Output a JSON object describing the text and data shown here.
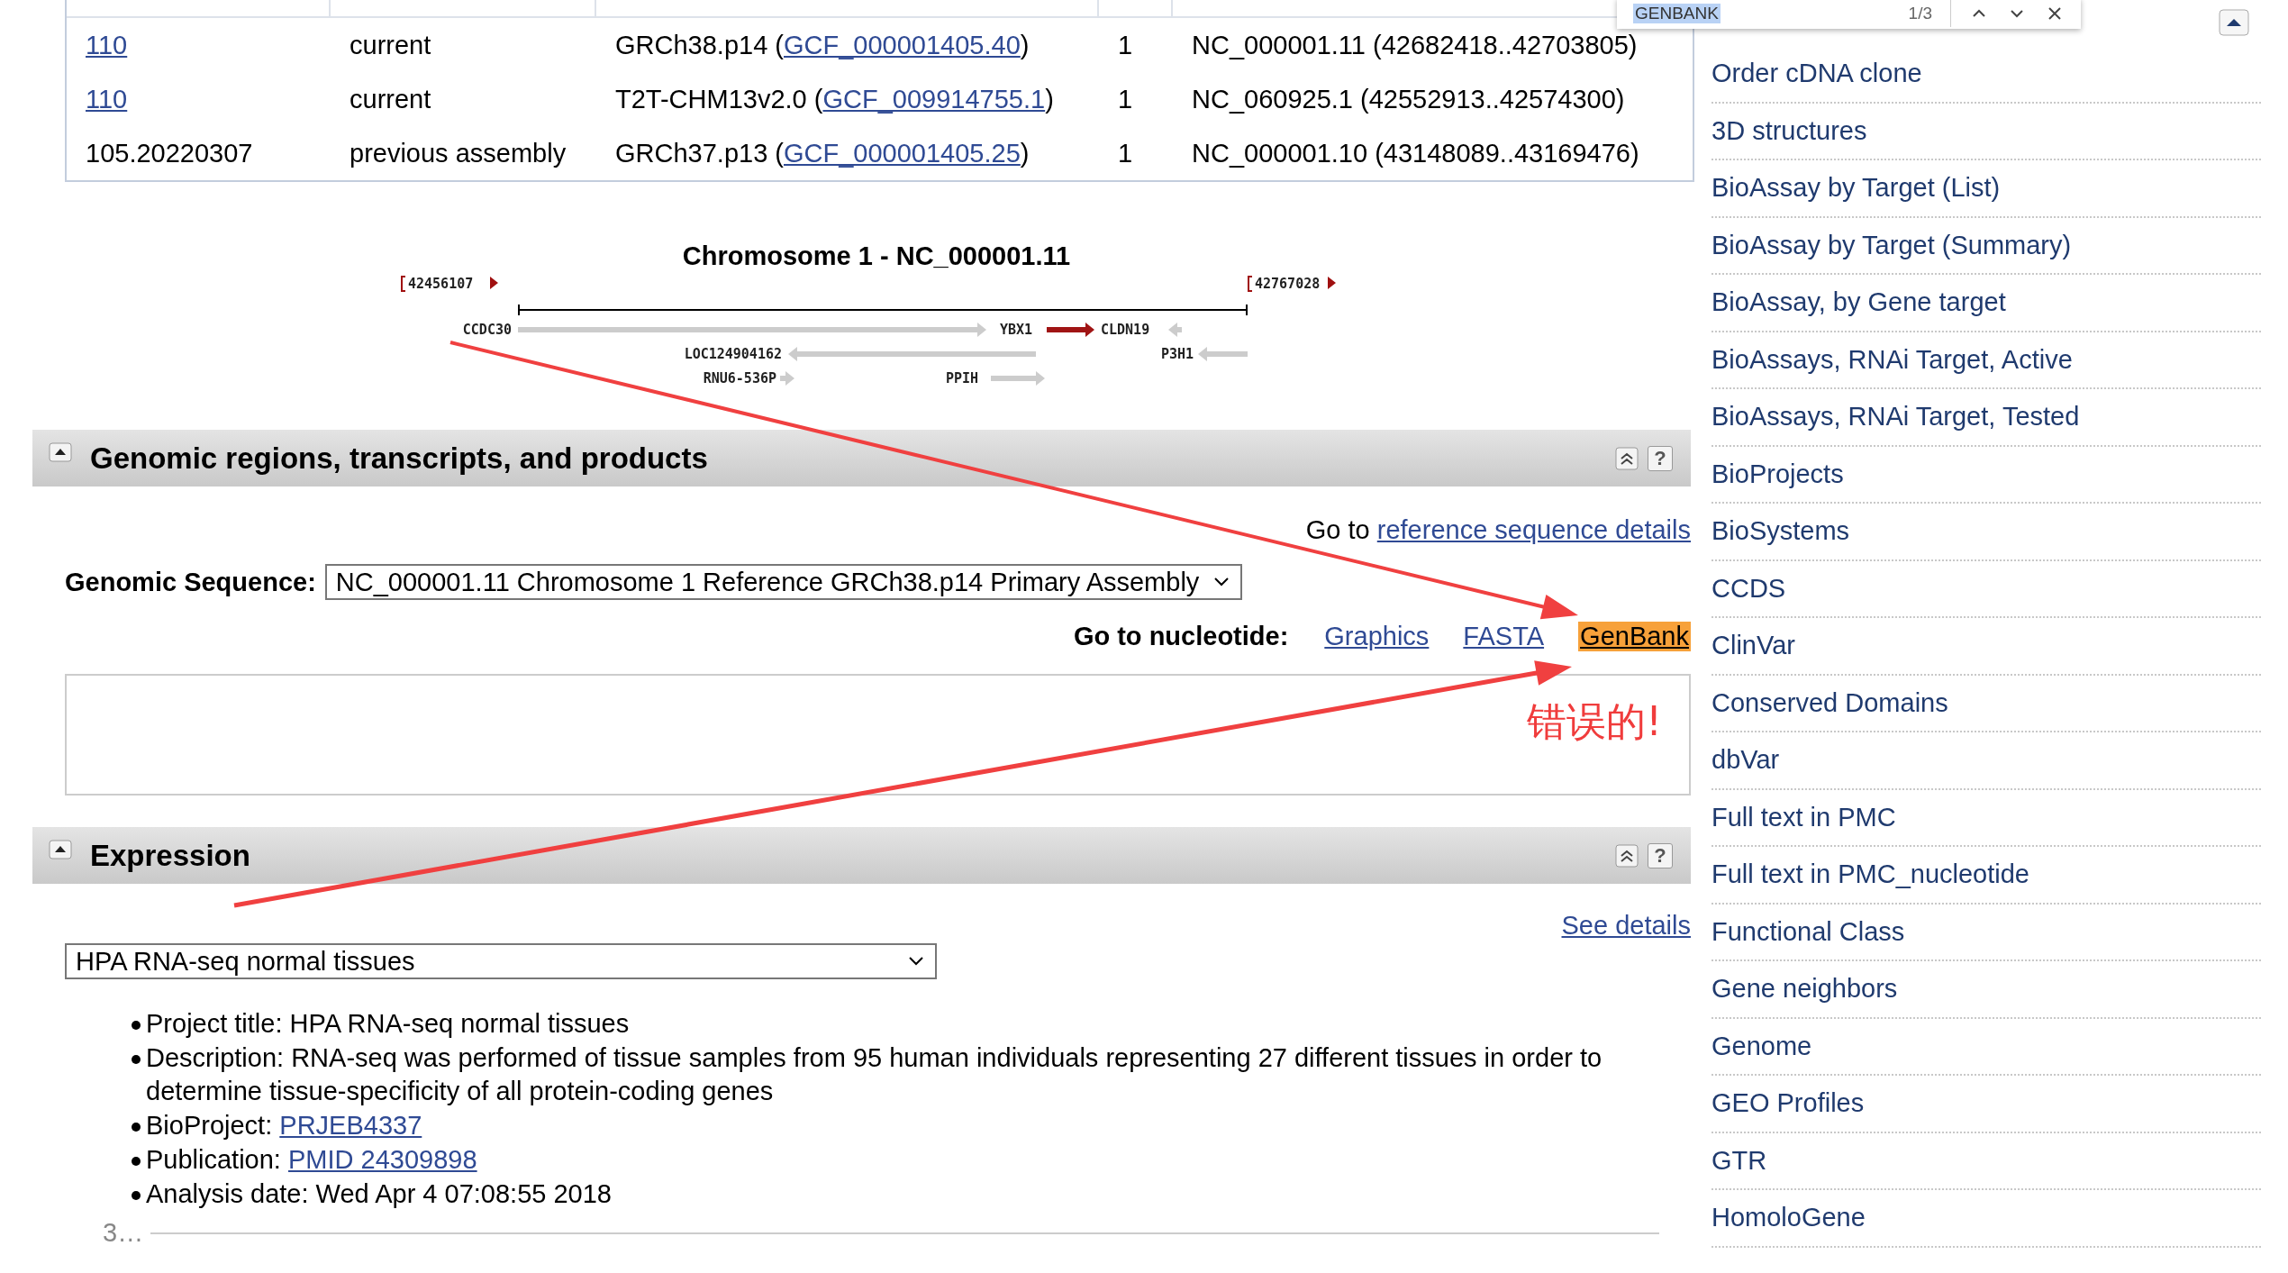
{
  "find_bar": {
    "query": "GENBANK",
    "count": "1/3"
  },
  "assembly_table": {
    "rows": [
      {
        "release": "110",
        "release_is_link": true,
        "status": "current",
        "assembly": "GRCh38.p14 (",
        "accession": "GCF_000001405.40",
        "accession_close": ")",
        "chromosome": "1",
        "location": "NC_000001.11 (42682418..42703805)"
      },
      {
        "release": "110",
        "release_is_link": true,
        "status": "current",
        "assembly": "T2T-CHM13v2.0 (",
        "accession": "GCF_009914755.1",
        "accession_close": ")",
        "chromosome": "1",
        "location": "NC_060925.1 (42552913..42574300)"
      },
      {
        "release": "105.20220307",
        "release_is_link": false,
        "status": "previous assembly",
        "assembly": "GRCh37.p13 (",
        "accession": "GCF_000001405.25",
        "accession_close": ")",
        "chromosome": "1",
        "location": "NC_000001.10 (43148089..43169476)"
      }
    ]
  },
  "gene_map": {
    "title": "Chromosome 1 - NC_000001.11",
    "start": "42456107",
    "end": "42767028",
    "genes": [
      {
        "label": "CCDC30",
        "points_right": true,
        "highlighted": false
      },
      {
        "label": "YBX1",
        "points_right": true,
        "highlighted": true
      },
      {
        "label": "CLDN19",
        "points_right": false,
        "highlighted": false
      },
      {
        "label": "LOC124904162",
        "points_right": false,
        "highlighted": false
      },
      {
        "label": "P3H1",
        "points_right": false,
        "highlighted": false
      },
      {
        "label": "RNU6-536P",
        "points_right": true,
        "highlighted": false
      },
      {
        "label": "PPIH",
        "points_right": true,
        "highlighted": false
      }
    ]
  },
  "genomic_section": {
    "title": "Genomic regions, transcripts, and products",
    "help": "?",
    "goto_prefix": "Go to",
    "goto_link": "reference sequence details",
    "sequence_label": "Genomic Sequence:",
    "sequence_value": "NC_000001.11 Chromosome 1 Reference GRCh38.p14 Primary Assembly",
    "nucleotide_label": "Go to nucleotide:",
    "nucleotide_links": [
      {
        "label": "Graphics",
        "highlighted": false
      },
      {
        "label": "FASTA",
        "highlighted": false
      },
      {
        "label": "GenBank",
        "highlighted": true
      }
    ]
  },
  "annotation": {
    "text": "错误的!"
  },
  "expression_section": {
    "title": "Expression",
    "help": "?",
    "details_link": "See details",
    "dataset": "HPA RNA-seq normal tissues",
    "facts": [
      {
        "text": "Project title: HPA RNA-seq normal tissues"
      },
      {
        "text": "Description: RNA-seq was performed of tissue samples from 95 human individuals representing 27 different tissues in order to determine tissue-specificity of all protein-coding genes"
      },
      {
        "text": "BioProject: ",
        "link": "PRJEB4337"
      },
      {
        "text": "Publication: ",
        "link": "PMID 24309898"
      },
      {
        "text": "Analysis date: Wed Apr 4 07:08:55 2018"
      }
    ],
    "more": "3…"
  },
  "sidebar": {
    "items": [
      "Order cDNA clone",
      "3D structures",
      "BioAssay by Target (List)",
      "BioAssay by Target (Summary)",
      "BioAssay, by Gene target",
      "BioAssays, RNAi Target, Active",
      "BioAssays, RNAi Target, Tested",
      "BioProjects",
      "BioSystems",
      "CCDS",
      "ClinVar",
      "Conserved Domains",
      "dbVar",
      "Full text in PMC",
      "Full text in PMC_nucleotide",
      "Functional Class",
      "Gene neighbors",
      "Genome",
      "GEO Profiles",
      "GTR",
      "HomoloGene"
    ]
  }
}
